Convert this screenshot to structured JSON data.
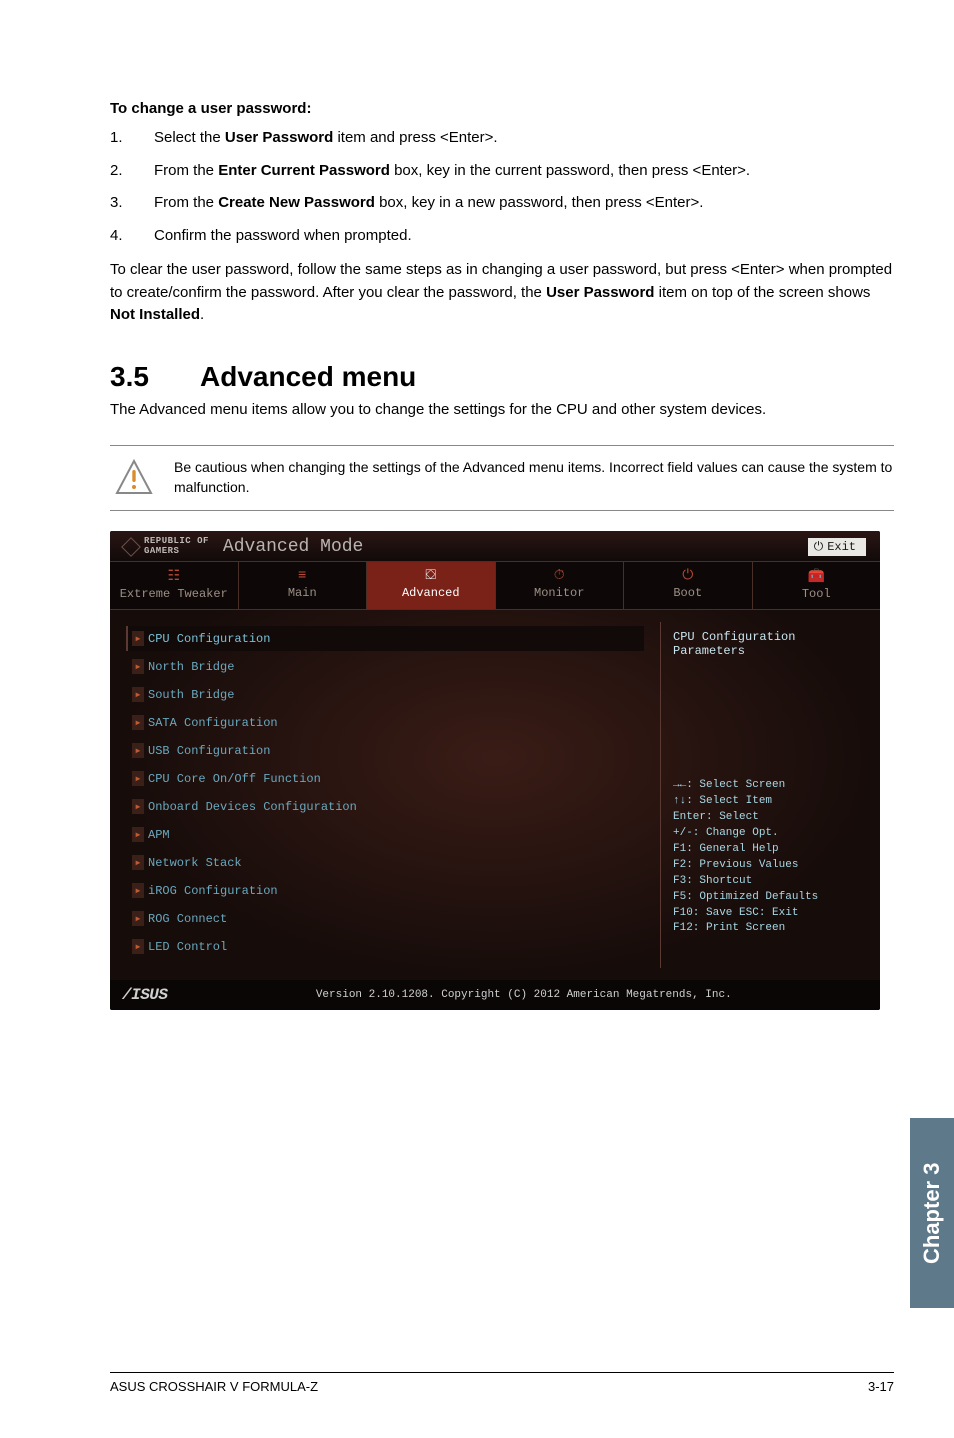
{
  "doc": {
    "change_pw_heading": "To change a user password:",
    "steps": [
      {
        "n": "1.",
        "text_a": "Select the ",
        "b1": "User Password",
        "text_b": " item and press <Enter>."
      },
      {
        "n": "2.",
        "text_a": "From the ",
        "b1": "Enter Current Password",
        "text_b": " box, key in the current password, then press <Enter>."
      },
      {
        "n": "3.",
        "text_a": "From the ",
        "b1": "Create New Password",
        "text_b": " box, key in a new password, then press <Enter>."
      },
      {
        "n": "4.",
        "text_a": "Confirm the password when prompted.",
        "b1": "",
        "text_b": ""
      }
    ],
    "clear_text_a": "To clear the user password, follow the same steps as in changing a user password, but press <Enter> when prompted to create/confirm the password. After you clear the password, the ",
    "clear_b1": "User Password",
    "clear_text_b": " item on top of the screen shows ",
    "clear_b2": "Not Installed",
    "clear_text_c": ".",
    "section_num": "3.5",
    "section_title": "Advanced menu",
    "section_desc": "The Advanced menu items allow you to change the settings for the CPU and other system devices.",
    "note": "Be cautious when changing the settings of the Advanced menu items. Incorrect field values can cause the system to malfunction."
  },
  "bios": {
    "brand_l1": "REPUBLIC OF",
    "brand_l2": "GAMERS",
    "mode": "Advanced Mode",
    "exit": "Exit",
    "tabs": [
      {
        "label": "Extreme Tweaker"
      },
      {
        "label": "Main"
      },
      {
        "label": "Advanced"
      },
      {
        "label": "Monitor"
      },
      {
        "label": "Boot"
      },
      {
        "label": "Tool"
      }
    ],
    "menu": [
      "CPU Configuration",
      "North Bridge",
      "South Bridge",
      "SATA Configuration",
      "USB Configuration",
      "CPU Core On/Off Function",
      "Onboard Devices Configuration",
      "APM",
      "Network Stack",
      "iROG Configuration",
      "ROG Connect",
      "LED Control"
    ],
    "help_title": "CPU Configuration Parameters",
    "help_lines": [
      "→←: Select Screen",
      "↑↓: Select Item",
      "Enter: Select",
      "+/-: Change Opt.",
      "F1: General Help",
      "F2: Previous Values",
      "F3: Shortcut",
      "F5: Optimized Defaults",
      "F10: Save  ESC: Exit",
      "F12: Print Screen"
    ],
    "copyright": "Version 2.10.1208. Copyright (C) 2012 American Megatrends, Inc.",
    "asus": "/ISUS"
  },
  "side_tab": "Chapter 3",
  "footer_left": "ASUS CROSSHAIR V FORMULA-Z",
  "footer_right": "3-17"
}
